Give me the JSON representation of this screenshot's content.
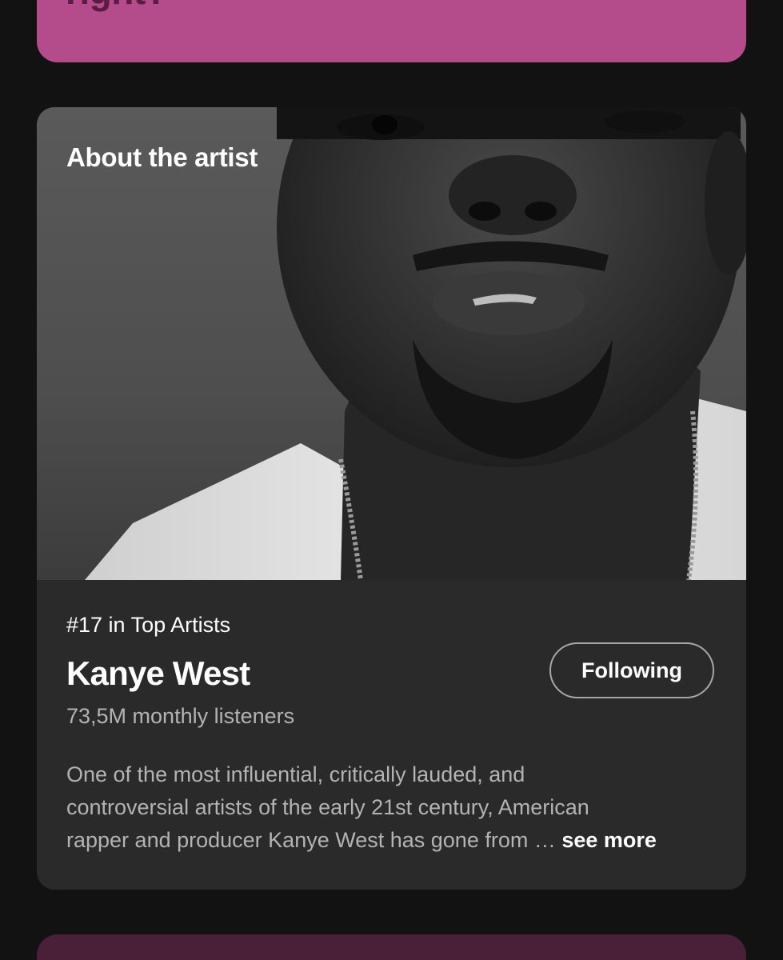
{
  "lyrics_card": {
    "text_fragment": "right?",
    "color": "#b44b8a"
  },
  "about": {
    "title": "About the artist",
    "rank": "#17 in Top Artists",
    "artist_name": "Kanye West",
    "follow_label": "Following",
    "listeners": "73,5M monthly listeners",
    "bio_lines": [
      "One of the most influential, critically lauded, and",
      "controversial artists of the early 21st century, American",
      "rapper and producer Kanye West has gone from …"
    ],
    "see_more_label": "see more",
    "card_color": "#2a2a2a"
  },
  "next_card": {
    "color": "#4a1f38"
  }
}
